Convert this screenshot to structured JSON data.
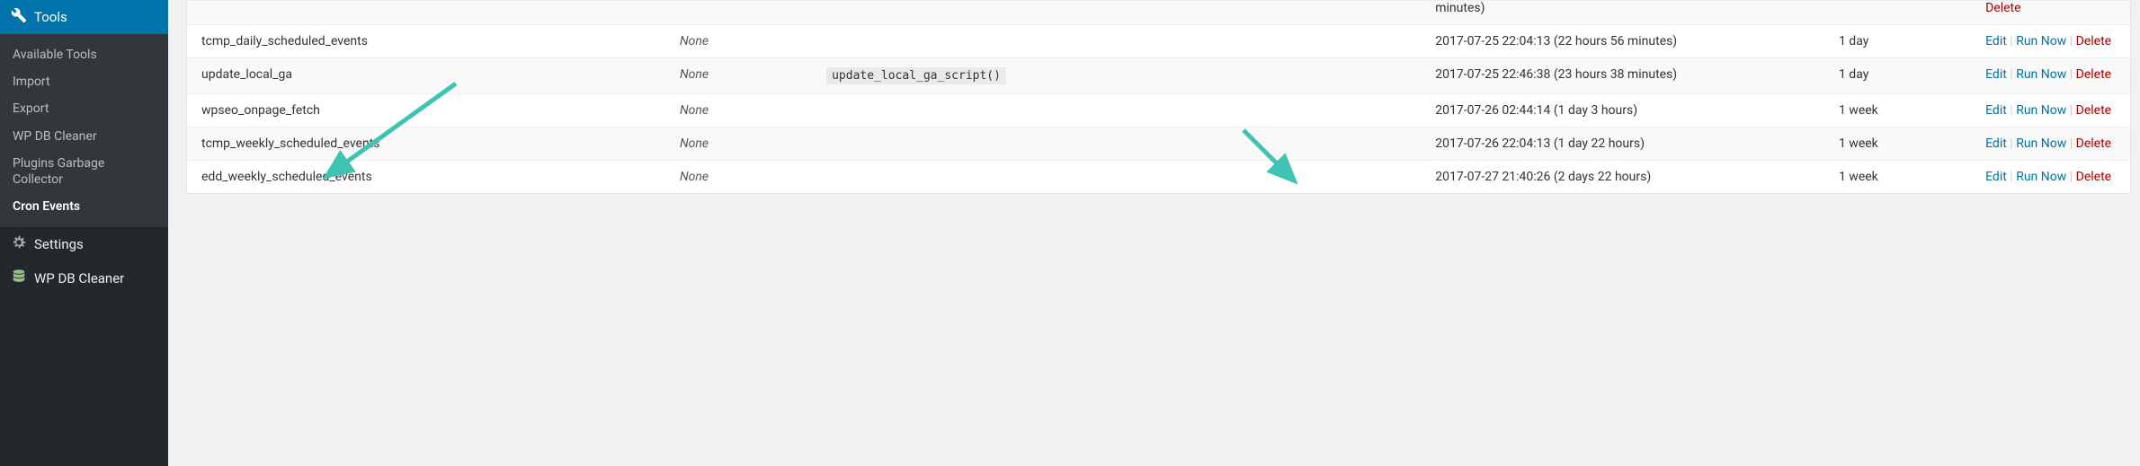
{
  "sidebar": {
    "active_label": "Tools",
    "sub_items": [
      {
        "label": "Available Tools",
        "current": false
      },
      {
        "label": "Import",
        "current": false
      },
      {
        "label": "Export",
        "current": false
      },
      {
        "label": "WP DB Cleaner",
        "current": false
      },
      {
        "label": "Plugins Garbage Collector",
        "current": false
      },
      {
        "label": "Cron Events",
        "current": true
      }
    ],
    "top_items": [
      {
        "label": "Settings",
        "icon": "settings"
      },
      {
        "label": "WP DB Cleaner",
        "icon": "db"
      }
    ]
  },
  "rows": [
    {
      "hook": "",
      "args": "",
      "action": "",
      "next": "minutes)",
      "recur": "",
      "partial": true
    },
    {
      "hook": "tcmp_daily_scheduled_events",
      "args": "None",
      "action": "",
      "next": "2017-07-25 22:04:13 (22 hours 56 minutes)",
      "recur": "1 day"
    },
    {
      "hook": "update_local_ga",
      "args": "None",
      "action": "update_local_ga_script()",
      "next": "2017-07-25 22:46:38 (23 hours 38 minutes)",
      "recur": "1 day"
    },
    {
      "hook": "wpseo_onpage_fetch",
      "args": "None",
      "action": "",
      "next": "2017-07-26 02:44:14 (1 day 3 hours)",
      "recur": "1 week"
    },
    {
      "hook": "tcmp_weekly_scheduled_events",
      "args": "None",
      "action": "",
      "next": "2017-07-26 22:04:13 (1 day 22 hours)",
      "recur": "1 week"
    },
    {
      "hook": "edd_weekly_scheduled_events",
      "args": "None",
      "action": "",
      "next": "2017-07-27 21:40:26 (2 days 22 hours)",
      "recur": "1 week"
    }
  ],
  "actions": {
    "edit": "Edit",
    "run": "Run Now",
    "del": "Delete"
  },
  "colors": {
    "accent": "#0073aa",
    "arrow": "#3fc4b4"
  }
}
